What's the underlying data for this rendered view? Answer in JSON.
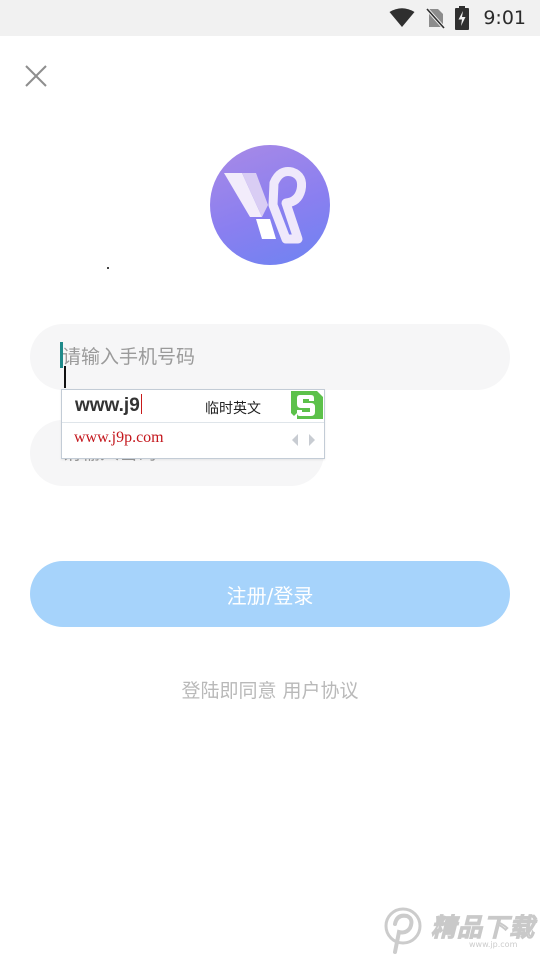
{
  "status_bar": {
    "time": "9:01",
    "icons": [
      "wifi-icon",
      "no-sim-icon",
      "battery-charging-icon"
    ]
  },
  "header": {
    "close_icon": "close-icon"
  },
  "logo": {
    "icon": "app-logo-icon",
    "colors": {
      "gradient_start": "#a98ae6",
      "gradient_end": "#6d83f2"
    }
  },
  "form": {
    "phone_placeholder": "请输入手机号码",
    "code_placeholder": "请输入密码",
    "submit_label": "注册/登录"
  },
  "ime": {
    "composition": "www.j9",
    "mode_label": "临时英文",
    "candidate": "www.j9p.com",
    "logo_icon": "sogou-s-icon"
  },
  "agreement": {
    "prefix": "登陆即同意",
    "link": "用户协议"
  },
  "watermark": {
    "text": "精品下载",
    "sub": "www.jp.com"
  },
  "colors": {
    "accent": "#a6d3fb",
    "field_bg": "#f6f6f7",
    "candidate_red": "#c4171d"
  }
}
